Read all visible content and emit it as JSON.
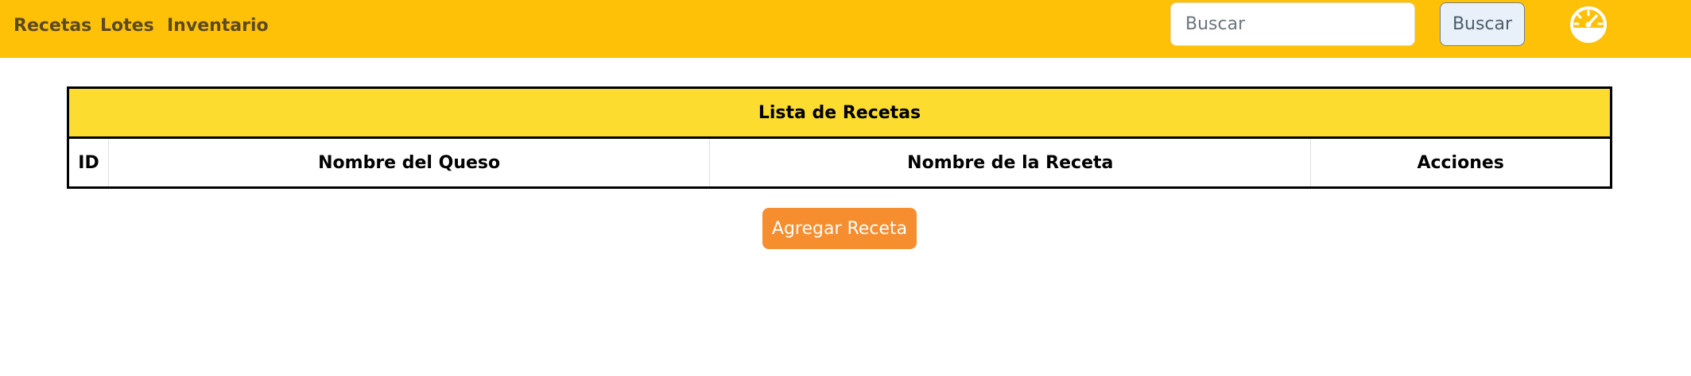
{
  "navbar": {
    "links": [
      {
        "label": "Recetas"
      },
      {
        "label": "Lotes"
      },
      {
        "label": "Inventario"
      }
    ],
    "search": {
      "placeholder": "Buscar",
      "value": ""
    },
    "search_button_label": "Buscar",
    "dashboard_icon": "speedometer-icon",
    "background_color": "#ffc107"
  },
  "table": {
    "caption": "Lista de Recetas",
    "columns": [
      "ID",
      "Nombre del Queso",
      "Nombre de la Receta",
      "Acciones"
    ],
    "rows": [],
    "caption_color": "#fbdc2f"
  },
  "add_button_label": "Agregar Receta",
  "add_button_color": "#f68d2e"
}
